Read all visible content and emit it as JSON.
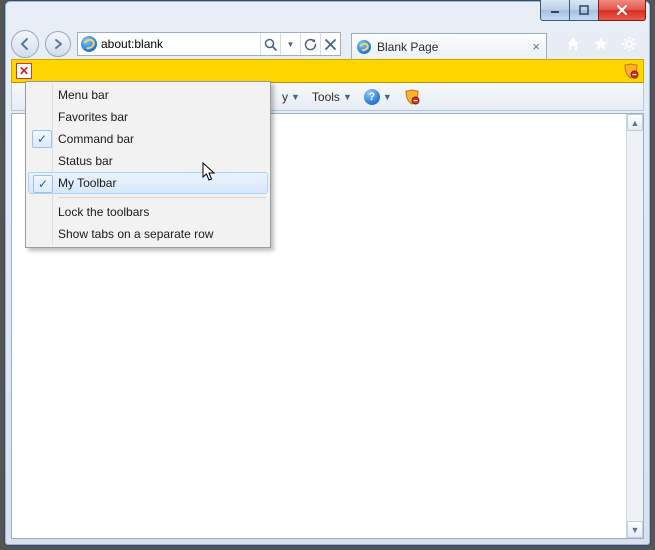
{
  "address": {
    "url": "about:blank",
    "placeholder": ""
  },
  "tab": {
    "title": "Blank Page"
  },
  "commandbar": {
    "visible_partial_label": "y",
    "tools_label": "Tools"
  },
  "context_menu": {
    "items": [
      {
        "label": "Menu bar",
        "checked": false
      },
      {
        "label": "Favorites bar",
        "checked": false
      },
      {
        "label": "Command bar",
        "checked": true
      },
      {
        "label": "Status bar",
        "checked": false
      },
      {
        "label": "My Toolbar",
        "checked": true,
        "hovered": true
      }
    ],
    "items2": [
      {
        "label": "Lock the toolbars"
      },
      {
        "label": "Show tabs on a separate row"
      }
    ]
  }
}
